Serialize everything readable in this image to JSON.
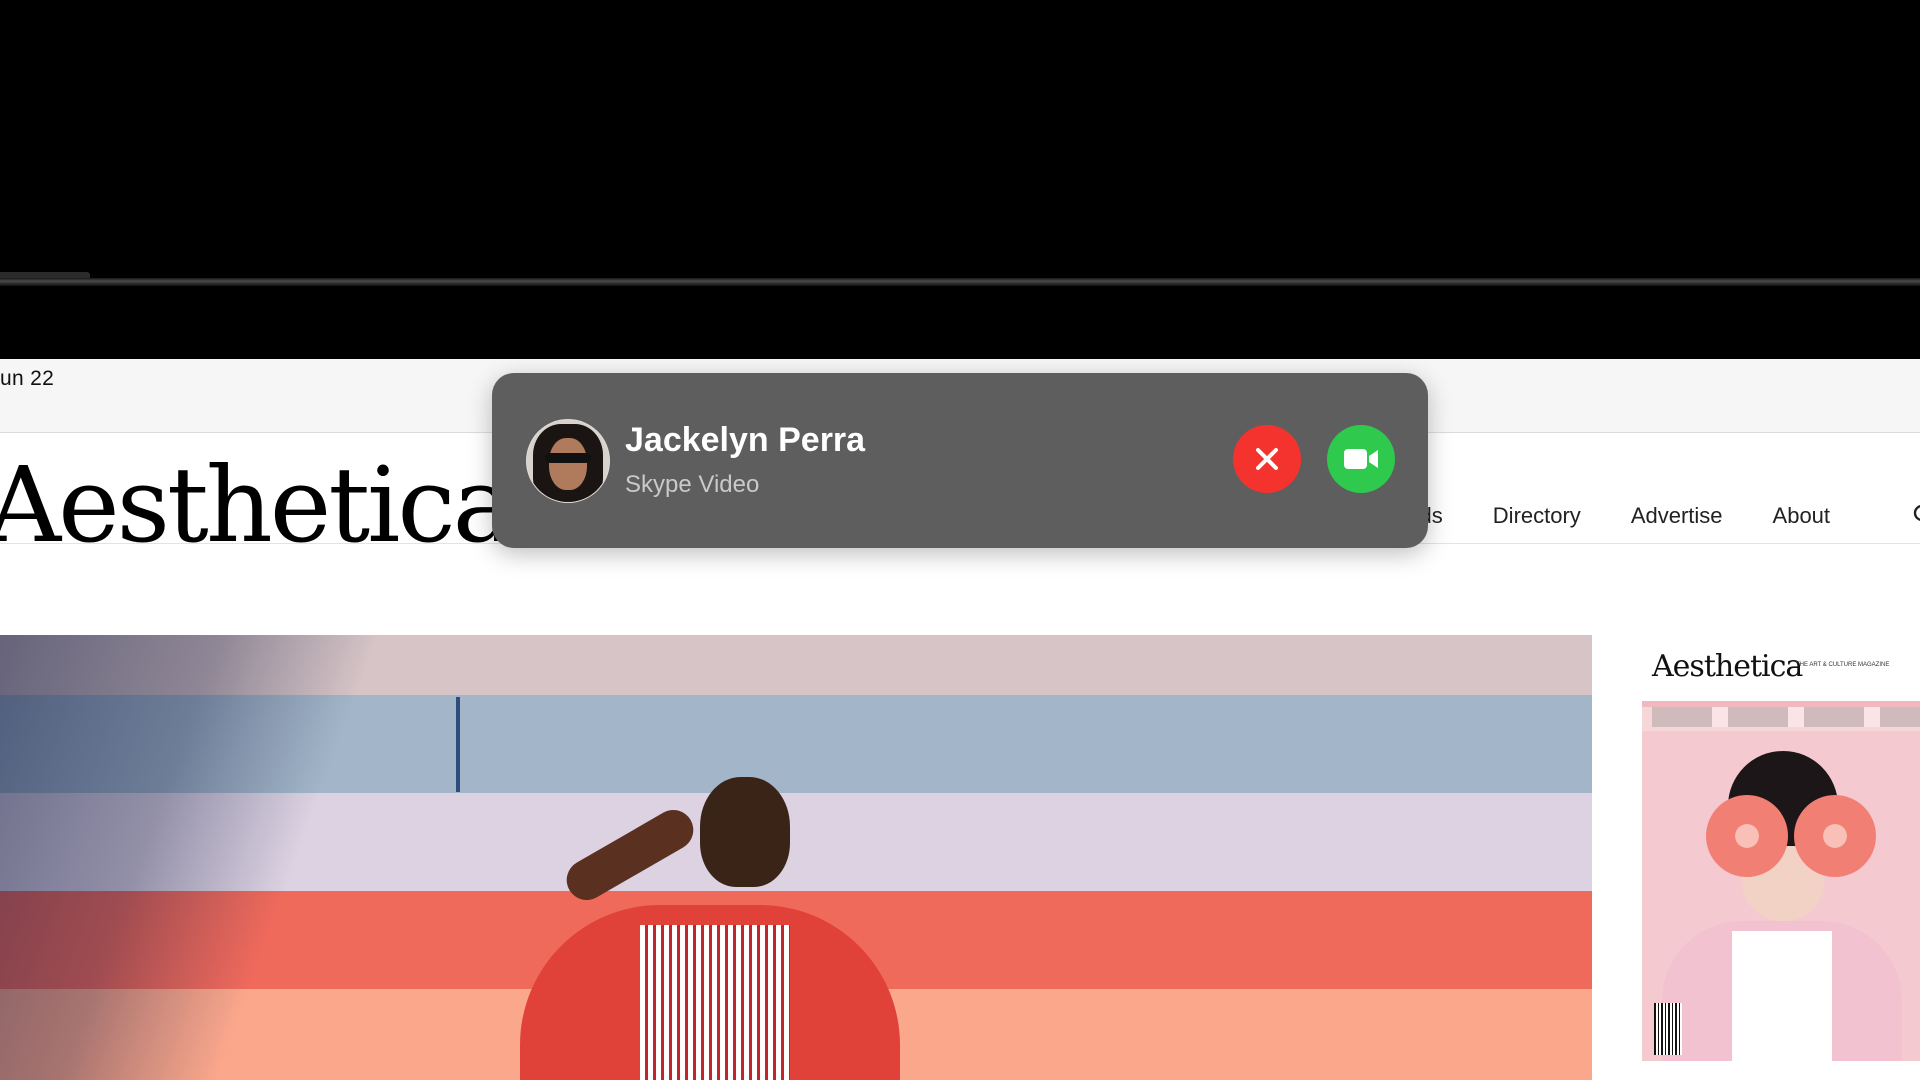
{
  "menubar": {
    "date": "un 22"
  },
  "site": {
    "logo": "Aesthetica",
    "nav": [
      "ards",
      "Directory",
      "Advertise",
      "About"
    ],
    "nav_cut_icon": "search-icon"
  },
  "magazine_cover": {
    "title": "Aesthetica",
    "tagline": "THE ART & CULTURE MAGAZINE"
  },
  "call": {
    "name": "Jackelyn Perra",
    "app": "Skype Video",
    "decline_icon": "close-icon",
    "accept_icon": "video-camera-icon",
    "colors": {
      "banner": "#5e5e5e",
      "decline": "#f4332f",
      "accept": "#2ec94d"
    }
  }
}
